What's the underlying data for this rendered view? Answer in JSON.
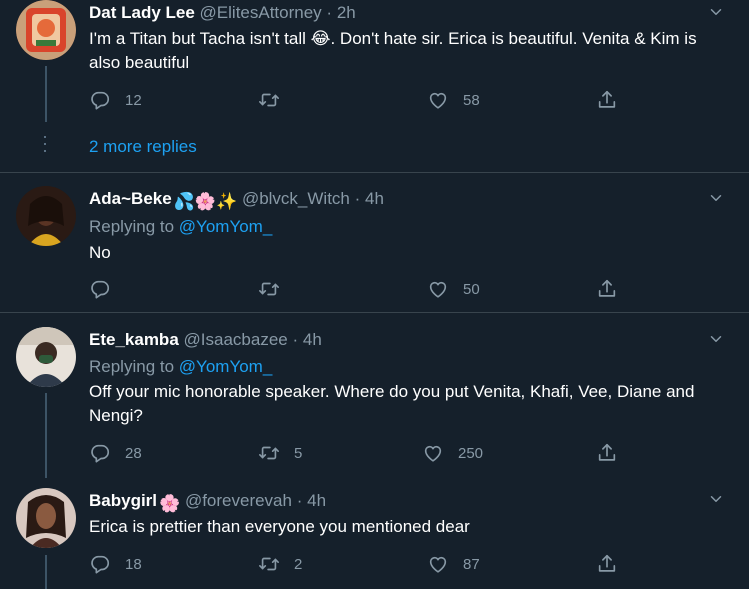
{
  "tweets": [
    {
      "name": "Dat Lady Lee",
      "handle": "@ElitesAttorney",
      "sep": "·",
      "time": "2h",
      "text": "I'm a Titan but Tacha isn't tall 😂. Don't hate sir. Erica is beautiful. Venita & Kim is also beautiful",
      "replies": "12",
      "retweets": "",
      "likes": "58",
      "more_replies": "2 more replies"
    },
    {
      "name": "Ada~Beke",
      "name_emoji": "💦🌸✨",
      "handle": "@blvck_Witch",
      "sep": "·",
      "time": "4h",
      "replying_label": "Replying to",
      "replying_to": "@YomYom_",
      "text": "No",
      "replies": "",
      "retweets": "",
      "likes": "50"
    },
    {
      "name": "Ete_kamba",
      "handle": "@Isaacbazee",
      "sep": "·",
      "time": "4h",
      "replying_label": "Replying to",
      "replying_to": "@YomYom_",
      "text": "Off your mic honorable speaker. Where do you put Venita, Khafi, Vee, Diane and Nengi?",
      "replies": "28",
      "retweets": "5",
      "likes": "250"
    },
    {
      "name": "Babygirl",
      "name_emoji": "🌸",
      "handle": "@foreverevah",
      "sep": "·",
      "time": "4h",
      "text": "Erica is prettier than everyone you mentioned dear",
      "replies": "18",
      "retweets": "2",
      "likes": "87"
    }
  ],
  "colors": {
    "background": "#15202b",
    "secondary_text": "#8899a6",
    "link": "#1da1f2",
    "divider": "#38444d"
  },
  "icons": [
    "reply-icon",
    "retweet-icon",
    "like-icon",
    "share-icon",
    "chevron-down-icon"
  ]
}
